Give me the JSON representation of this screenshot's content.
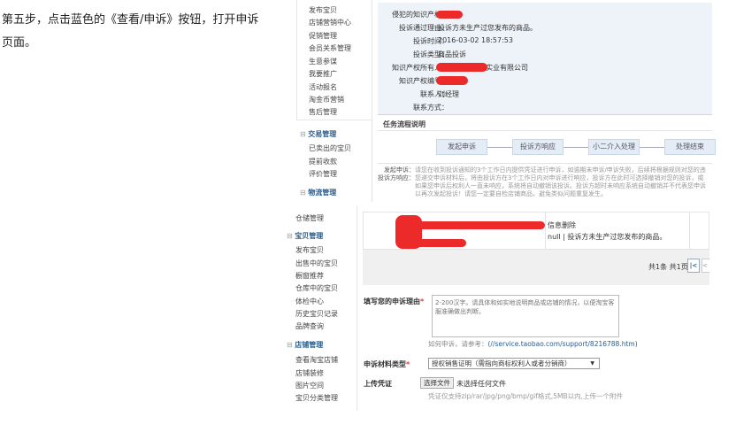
{
  "intro": "第五步，点击蓝色的《查看/申诉》按钮，打开申诉页面。",
  "top": {
    "sidebar": {
      "items": [
        "发布宝贝",
        "店铺营销中心",
        "促销管理",
        "会员关系管理",
        "生意参谋",
        "我要推广",
        "活动报名",
        "淘金币营销",
        "售后管理"
      ],
      "group2": "交易管理",
      "group2_items": [
        "已卖出的宝贝",
        "提前收款",
        "评价管理"
      ],
      "group3": "物流管理"
    },
    "info": {
      "labels": [
        "侵犯的知识产权：",
        "投诉通过理由：",
        "投诉时间：",
        "投诉类型：",
        "知识产权所有人：",
        "知识产权编号：",
        "联系人：",
        "联系方式："
      ],
      "reason": "投诉方未生产过您发布的商品。",
      "time": "2016-03-02 18:57:53",
      "type": "商品投诉",
      "owner_suffix": "实业有限公司",
      "contact": "刘经理"
    },
    "flow_title": "任务流程说明",
    "flow_steps": [
      "发起申诉",
      "投诉方响应",
      "小二介入处理",
      "处理结束"
    ],
    "notes": [
      {
        "label": "发起申诉：",
        "text": "请您在收到投诉通知的3个工作日内提供凭证进行申诉，如逾期未申诉/申诉失败，后续将根据规则对您的违"
      },
      {
        "label": "投诉方响应：",
        "text": "您递交申诉材料后，将由投诉方在3个工作日内对申诉进行响应，投诉方在此时可选择撤销对您的投诉，或"
      }
    ],
    "notes_more": [
      "如果您申诉后权利人一直未响应，系统将自动撤销该投诉。投诉方超时未响应系统自动撤销并不代表您申诉",
      "以再次发起投诉！请您一定要自检店铺商品，避免类似问题重复发生。"
    ]
  },
  "bottom": {
    "sidebar": {
      "top_item": "仓储管理",
      "group1": "宝贝管理",
      "group1_items": [
        "发布宝贝",
        "出售中的宝贝",
        "橱窗推荐",
        "仓库中的宝贝",
        "体检中心",
        "历史宝贝记录",
        "品牌查询"
      ],
      "group2": "店铺管理",
      "group2_items": [
        "查看淘宝店铺",
        "店铺装修",
        "图片空间",
        "宝贝分类管理"
      ]
    },
    "row": {
      "status": "信息删除",
      "reason": "null | 投诉方未生产过您发布的商品。"
    },
    "pager": {
      "summary": "共1条 共1页",
      "first": "|<",
      "prev": "<"
    },
    "form": {
      "reason_label": "填写您的申诉理由",
      "required": "*",
      "reason_placeholder": "2-200汉字。请具体和如实地说明商品或店铺的情况，以便淘宝客服准确做出判断。",
      "help_prefix": "如何申诉，请参考：",
      "help_link": "(//service.taobao.com/support/8216788.htm)",
      "material_label": "申诉材料类型",
      "material_value": "授权销售证明（需指向商标权利人或者分销商）",
      "upload_label": "上传凭证",
      "choose_file": "选择文件",
      "no_file": "未选择任何文件",
      "upload_hint": "凭证仅支持zip/rar/jpg/png/bmp/gif格式,5MB以内,上传一个附件"
    }
  }
}
